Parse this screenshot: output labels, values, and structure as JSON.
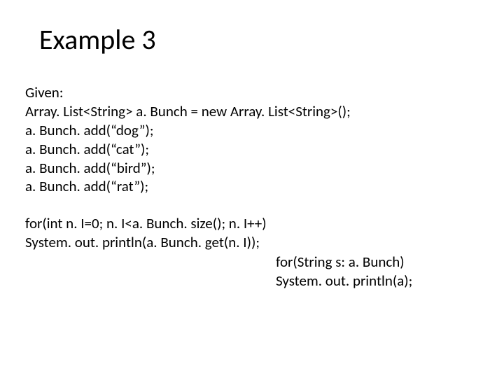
{
  "title": "Example 3",
  "intro": "Given:",
  "code1_line1": "Array. List<String> a. Bunch = new Array. List<String>();",
  "code1_line2": "a. Bunch. add(“dog”);",
  "code1_line3": "a. Bunch. add(“cat”);",
  "code1_line4": "a. Bunch. add(“bird”);",
  "code1_line5": "a. Bunch. add(“rat”);",
  "code2_line1": "for(int n. I=0; n. I<a. Bunch. size(); n. I++)",
  "code2_line2": "System. out. println(a. Bunch. get(n. I));",
  "code3_line1": "for(String s: a. Bunch)",
  "code3_line2": " System. out. println(a);"
}
